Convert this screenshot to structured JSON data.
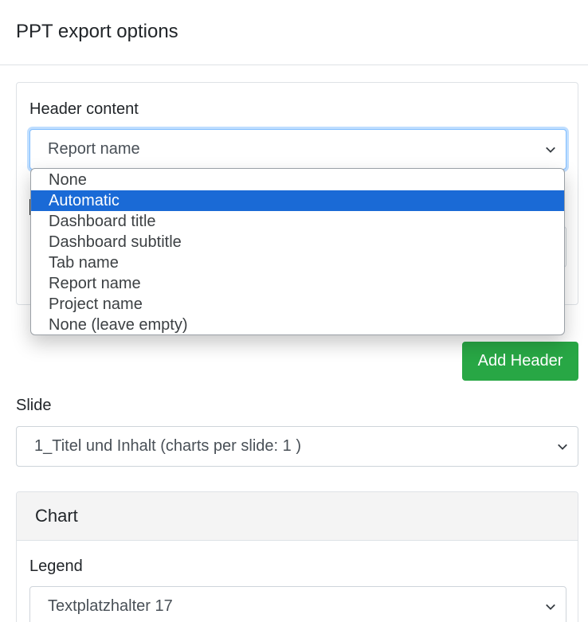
{
  "modal": {
    "title": "PPT export options"
  },
  "header_section": {
    "label": "Header content",
    "selected": "Report name",
    "options": [
      "None",
      "Automatic",
      "Dashboard title",
      "Dashboard subtitle",
      "Tab name",
      "Report name",
      "Project name",
      "None (leave empty)"
    ],
    "highlighted_option": "Automatic",
    "add_button": "Add Header"
  },
  "slide": {
    "label": "Slide",
    "selected": "1_Titel und Inhalt (charts per slide: 1 )"
  },
  "chart": {
    "title": "Chart",
    "legend_label": "Legend",
    "legend_selected": "Textplatzhalter 17"
  },
  "colors": {
    "accent_green": "#28a745",
    "highlight_blue": "#1a6ad6",
    "focus_border": "#80bdff"
  }
}
